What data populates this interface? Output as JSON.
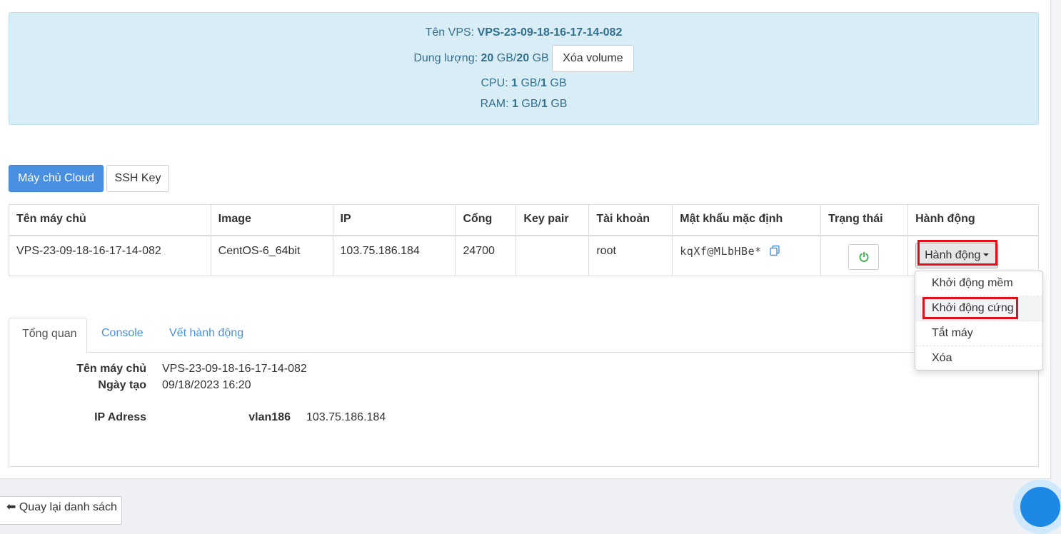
{
  "vps_info": {
    "name_label": "Tên VPS:",
    "name_value": "VPS-23-09-18-16-17-14-082",
    "storage_label": "Dung lượng:",
    "storage_used": "20",
    "storage_total": "20",
    "unit": "GB",
    "delete_volume_button": "Xóa volume",
    "cpu_label": "CPU:",
    "cpu_used": "1",
    "cpu_total": "1",
    "ram_label": "RAM:",
    "ram_used": "1",
    "ram_total": "1"
  },
  "toggle": {
    "cloud_label": "Máy chủ Cloud",
    "ssh_label": "SSH Key"
  },
  "table": {
    "headers": [
      "Tên máy chủ",
      "Image",
      "IP",
      "Cổng",
      "Key pair",
      "Tài khoản",
      "Mật khẩu mặc định",
      "Trạng thái",
      "Hành động"
    ],
    "row": {
      "name": "VPS-23-09-18-16-17-14-082",
      "image": "CentOS-6_64bit",
      "ip": "103.75.186.184",
      "port": "24700",
      "keypair": "",
      "account": "root",
      "password": "kqXf@MLbHBe*",
      "status_icon": "power-icon",
      "action_label": "Hành động"
    }
  },
  "dropdown": {
    "items": [
      "Khởi động mềm",
      "Khởi động cứng",
      "Tắt máy",
      "Xóa"
    ]
  },
  "tabs": {
    "items": [
      "Tổng quan",
      "Console",
      "Vết hành động"
    ]
  },
  "overview": {
    "name_label": "Tên máy chủ",
    "name_value": "VPS-23-09-18-16-17-14-082",
    "created_label": "Ngày tạo",
    "created_value": "09/18/2023 16:20",
    "ip_label": "IP Adress",
    "vlan_label": "vlan186",
    "vlan_ip": "103.75.186.184"
  },
  "footer": {
    "back_label": "Quay lại danh sách"
  },
  "colors": {
    "primary": "#4a90e2",
    "info_bg": "#d9edf7",
    "info_text": "#31708f",
    "highlight": "#e0101a",
    "power_green": "#2fb344"
  }
}
